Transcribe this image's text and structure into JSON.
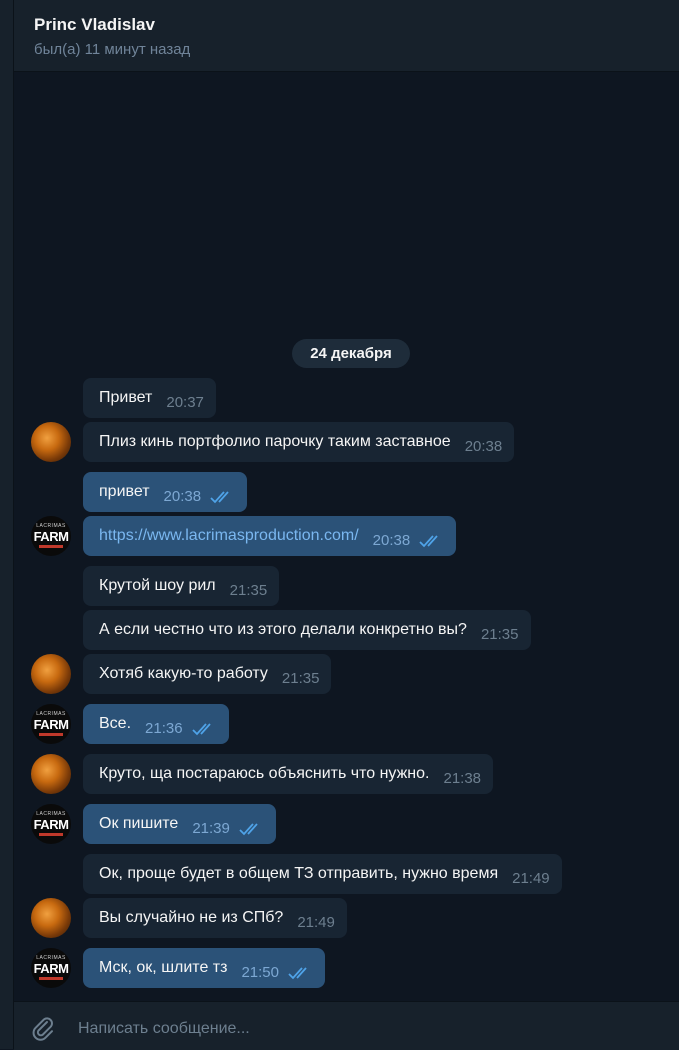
{
  "header": {
    "name": "Princ Vladislav",
    "status": "был(а) 11 минут назад"
  },
  "date_separator": "24 декабря",
  "messages": [
    {
      "text": "Привет",
      "time": "20:37",
      "dir": "in"
    },
    {
      "text": "Плиз кинь портфолио парочку таким заставное",
      "time": "20:38",
      "dir": "in"
    },
    {
      "text": "привет",
      "time": "20:38",
      "dir": "out",
      "read": true
    },
    {
      "text": "https://www.lacrimasproduction.com/",
      "time": "20:38",
      "dir": "out",
      "read": true,
      "link": true
    },
    {
      "text": "Крутой шоу рил",
      "time": "21:35",
      "dir": "in"
    },
    {
      "text": "А если честно что из этого делали конкретно вы?",
      "time": "21:35",
      "dir": "in"
    },
    {
      "text": "Хотяб какую-то работу",
      "time": "21:35",
      "dir": "in"
    },
    {
      "text": "Все.",
      "time": "21:36",
      "dir": "out",
      "read": true
    },
    {
      "text": "Круто, ща постараюсь объяснить что нужно.",
      "time": "21:38",
      "dir": "in"
    },
    {
      "text": "Ок пишите",
      "time": "21:39",
      "dir": "out",
      "read": true
    },
    {
      "text": "Ок, проще будет в общем ТЗ отправить, нужно время",
      "time": "21:49",
      "dir": "in"
    },
    {
      "text": "Вы случайно не из СПб?",
      "time": "21:49",
      "dir": "in"
    },
    {
      "text": "Мск, ок, шлите тз",
      "time": "21:50",
      "dir": "out",
      "read": true
    }
  ],
  "avatars": {
    "contact": "planet-avatar",
    "self": {
      "line1": "LACRIMAS",
      "line2": "FARM"
    }
  },
  "composer": {
    "placeholder": "Написать сообщение..."
  },
  "colors": {
    "background": "#0e1621",
    "panel": "#17212b",
    "incoming_bubble": "#182533",
    "outgoing_bubble": "#2b5278",
    "link": "#7ab7f0",
    "read_ticks": "#4fa3e8"
  }
}
